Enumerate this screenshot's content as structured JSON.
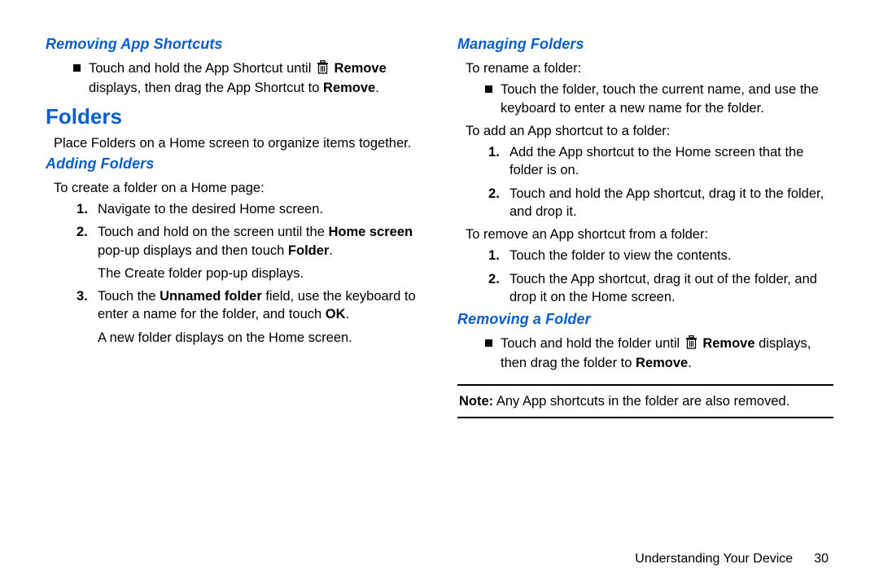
{
  "left": {
    "h_removing_app_shortcuts": "Removing App Shortcuts",
    "bullet1_pre": "Touch and hold the App Shortcut until ",
    "bullet1_bold": "Remove",
    "bullet1_line2a": "displays, then drag the App Shortcut to ",
    "bullet1_line2b": "Remove",
    "bullet1_line2c": ".",
    "h_folders": "Folders",
    "folders_intro": "Place Folders on a Home screen to organize items together.",
    "h_adding_folders": "Adding Folders",
    "adding_intro": "To create a folder on a Home page:",
    "step1": "Navigate to the desired Home screen.",
    "step2_pre": "Touch and hold on the screen until the ",
    "step2_bold1": "Home screen",
    "step2_line2a": "pop-up displays and then touch ",
    "step2_bold2": "Folder",
    "step2_line2b": ".",
    "step2_sub": "The Create folder pop-up displays.",
    "step3_pre": "Touch the ",
    "step3_bold1": "Unnamed folder",
    "step3_mid": " field, use the keyboard to enter a name for the folder, and touch ",
    "step3_bold2": "OK",
    "step3_end": ".",
    "step3_sub": "A new folder displays on the Home screen."
  },
  "right": {
    "h_managing_folders": "Managing Folders",
    "rename_intro": "To rename a folder:",
    "rename_bullet": "Touch the folder, touch the current name, and use the keyboard to enter a new name for the folder.",
    "addshort_intro": "To add an App shortcut to a folder:",
    "add_step1": "Add the App shortcut to the Home screen that the folder is on.",
    "add_step2": "Touch and hold the App shortcut, drag it to the folder, and drop it.",
    "removeshort_intro": "To remove an App shortcut from a folder:",
    "rem_step1": "Touch the folder to view the contents.",
    "rem_step2": "Touch the App shortcut, drag it out of the folder, and drop it on the Home screen.",
    "h_removing_folder": "Removing a Folder",
    "remfolder_bullet_pre": "Touch and hold the folder until ",
    "remfolder_bullet_bold": "Remove",
    "remfolder_bullet_mid": " displays, then drag the folder to ",
    "remfolder_bullet_bold2": "Remove",
    "remfolder_bullet_end": ".",
    "note_label": "Note:",
    "note_text": " Any App shortcuts in the folder are also removed."
  },
  "footer": {
    "section": "Understanding Your Device",
    "page": "30"
  }
}
